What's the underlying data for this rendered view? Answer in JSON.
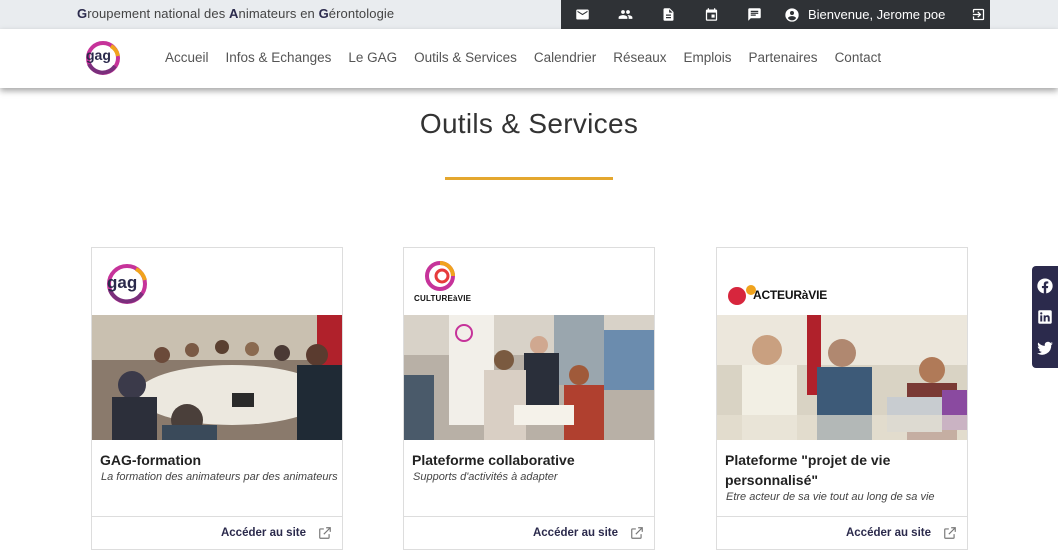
{
  "topbar": {
    "org_parts": [
      {
        "initial": "G",
        "rest": "roupement national des "
      },
      {
        "initial": "A",
        "rest": "nimateurs en "
      },
      {
        "initial": "G",
        "rest": "érontologie"
      }
    ],
    "welcome": "Bienvenue, Jerome poe",
    "icons": [
      "mail-icon",
      "people-icon",
      "document-icon",
      "calendar-icon",
      "chat-icon",
      "account-icon",
      "logout-icon"
    ]
  },
  "nav": {
    "items": [
      "Accueil",
      "Infos & Echanges",
      "Le GAG",
      "Outils & Services",
      "Calendrier",
      "Réseaux",
      "Emplois",
      "Partenaires",
      "Contact"
    ]
  },
  "page": {
    "title": "Outils & Services",
    "accent_color": "#e4a72e"
  },
  "cards": [
    {
      "title": "GAG-formation",
      "subtitle": "La formation des animateurs par des animateurs",
      "link": "Accéder au site",
      "logo": "gag-logo"
    },
    {
      "title": "Plateforme collaborative",
      "subtitle": "Supports d'activités à adapter",
      "link": "Accéder au site",
      "logo": "culture-a-vie-logo",
      "logo_text": "CULTUREàVIE"
    },
    {
      "title": "Plateforme \"projet de vie personnalisé\"",
      "subtitle": "Etre acteur de sa vie tout au long de sa vie",
      "link": "Accéder au site",
      "logo": "acteur-a-vie-logo",
      "logo_text": "ACTEURàVIE"
    }
  ],
  "social": [
    "facebook-icon",
    "linkedin-icon",
    "twitter-icon"
  ],
  "colors": {
    "brand_dark": "#2b2a4c",
    "topbar_bg": "#e9ecef",
    "userbar_bg": "#2f3236"
  }
}
